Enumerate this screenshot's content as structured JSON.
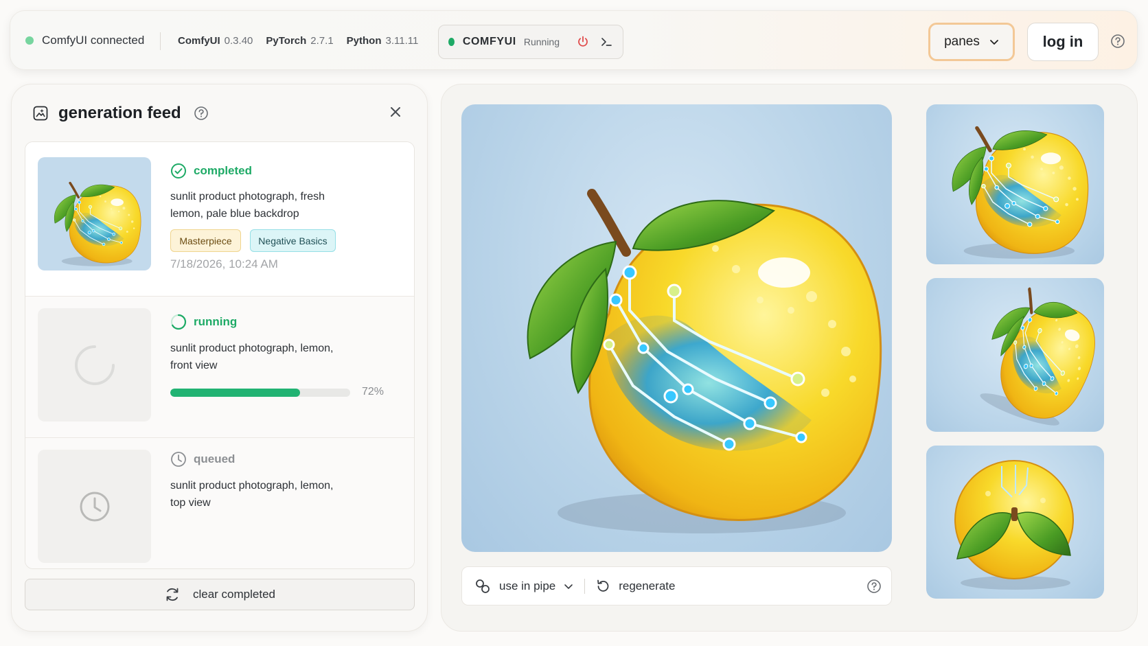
{
  "topbar": {
    "connection_status": "ComfyUI connected",
    "versions": [
      {
        "name": "ComfyUI",
        "value": "0.3.40"
      },
      {
        "name": "PyTorch",
        "value": "2.7.1"
      },
      {
        "name": "Python",
        "value": "3.11.11"
      }
    ],
    "service": {
      "name": "COMFYUI",
      "status": "Running"
    },
    "panes_label": "panes",
    "login_label": "log in"
  },
  "feed": {
    "title": "generation feed",
    "items": [
      {
        "status": "completed",
        "prompt": "sunlit product photograph, fresh lemon, pale blue backdrop",
        "tags": [
          "Masterpiece",
          "Negative Basics"
        ],
        "timestamp": "7/18/2026, 10:24 AM"
      },
      {
        "status": "running",
        "prompt": "sunlit product photograph, lemon, front view",
        "progress_label": "72%",
        "progress": 0.72
      },
      {
        "status": "queued",
        "prompt": "sunlit product photograph, lemon, top view"
      }
    ],
    "clear_label": "clear completed"
  },
  "viewer": {
    "use_in_pipe_label": "use in pipe",
    "regenerate_label": "regenerate"
  },
  "colors": {
    "accent_green": "#21b373",
    "completed": "#1eaa66",
    "panes_border": "#f3c896",
    "lemon": "#f6c81c",
    "circuit": "#1fa6e8"
  },
  "icons": [
    "power-icon",
    "terminal-icon",
    "chevron-down-icon",
    "help-icon",
    "image-sparkle-icon",
    "close-icon",
    "check-circle-icon",
    "spinner-icon",
    "clock-icon",
    "refresh-icon",
    "link-icon",
    "undo-icon"
  ]
}
